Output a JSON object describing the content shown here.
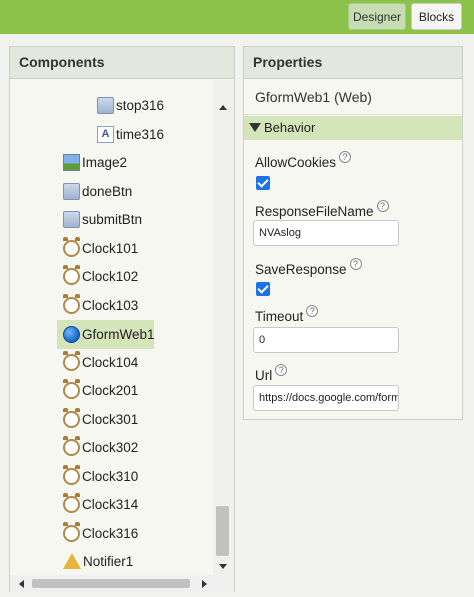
{
  "toolbar": {
    "designer_label": "Designer",
    "blocks_label": "Blocks"
  },
  "components": {
    "title": "Components",
    "items": [
      {
        "label": "stop316",
        "icon": "button-icon"
      },
      {
        "label": "time316",
        "icon": "label-icon",
        "glyph": "A"
      },
      {
        "label": "Image2",
        "icon": "image-icon"
      },
      {
        "label": "doneBtn",
        "icon": "button-icon"
      },
      {
        "label": "submitBtn",
        "icon": "button-icon"
      },
      {
        "label": "Clock101",
        "icon": "clock-icon"
      },
      {
        "label": "Clock102",
        "icon": "clock-icon"
      },
      {
        "label": "Clock103",
        "icon": "clock-icon"
      },
      {
        "label": "GformWeb1",
        "icon": "web-globe-icon",
        "selected": true
      },
      {
        "label": "Clock104",
        "icon": "clock-icon"
      },
      {
        "label": "Clock201",
        "icon": "clock-icon"
      },
      {
        "label": "Clock301",
        "icon": "clock-icon"
      },
      {
        "label": "Clock302",
        "icon": "clock-icon"
      },
      {
        "label": "Clock310",
        "icon": "clock-icon"
      },
      {
        "label": "Clock314",
        "icon": "clock-icon"
      },
      {
        "label": "Clock316",
        "icon": "clock-icon"
      },
      {
        "label": "Notifier1",
        "icon": "notifier-warning-icon"
      }
    ]
  },
  "properties": {
    "title": "Properties",
    "component_name": "GformWeb1 (Web)",
    "group": "Behavior",
    "help_glyph": "?",
    "allow_cookies": {
      "label": "AllowCookies",
      "checked": true
    },
    "response_file_name": {
      "label": "ResponseFileName",
      "value": "NVAslog"
    },
    "save_response": {
      "label": "SaveResponse",
      "checked": true
    },
    "timeout": {
      "label": "Timeout",
      "value": "0"
    },
    "url": {
      "label": "Url",
      "value": "https://docs.google.com/forms/"
    }
  },
  "colors": {
    "topbar": "#8bc34a",
    "selection": "#d4e5b9",
    "checkbox": "#1a73e8"
  }
}
